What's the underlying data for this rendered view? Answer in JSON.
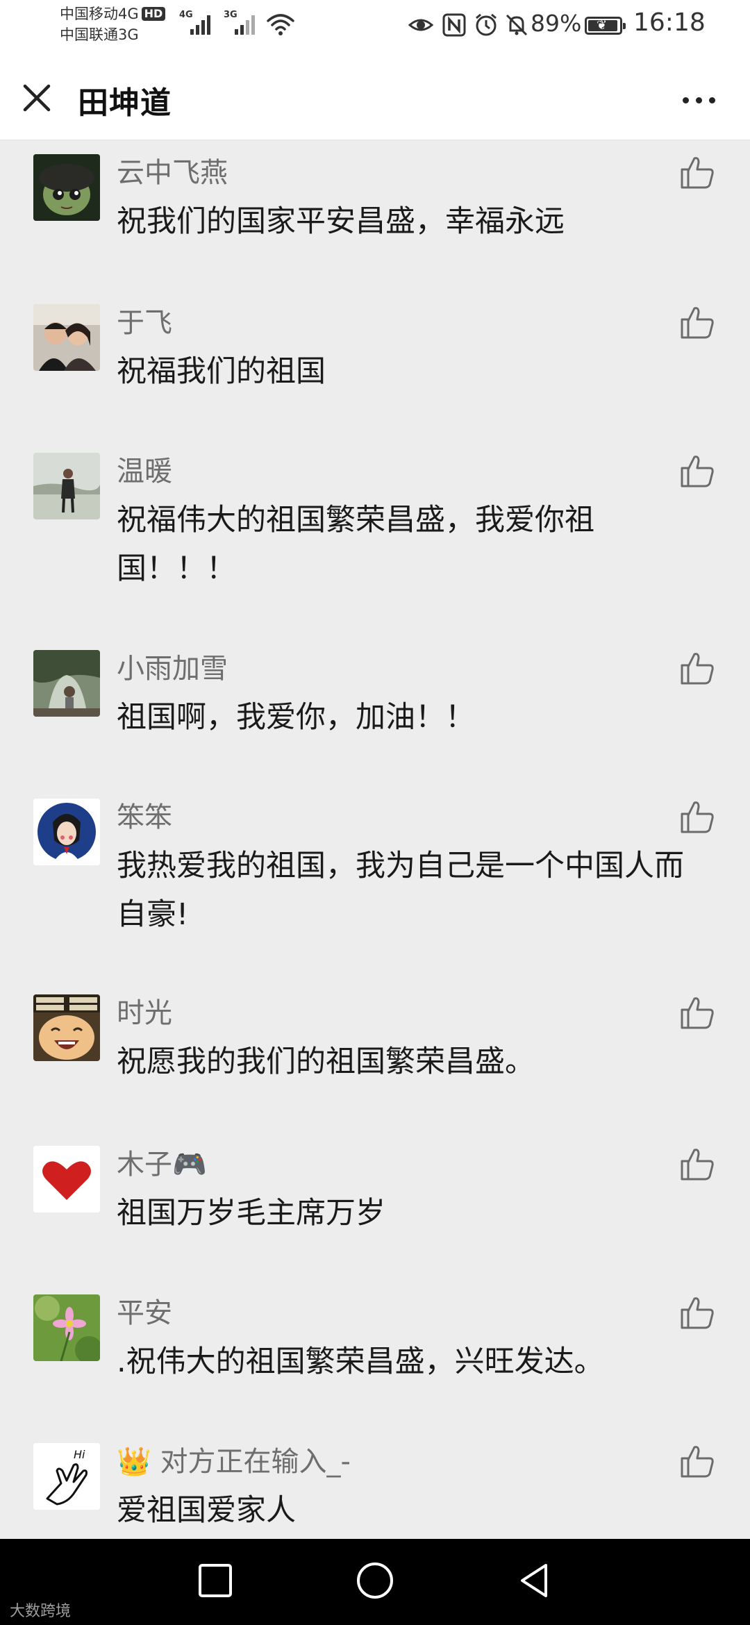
{
  "status_bar": {
    "carrier1": "中国移动4G",
    "hd": "HD",
    "carrier2": "中国联通3G",
    "sig1_gen": "4G",
    "sig2_gen": "3G",
    "battery": "89%",
    "time": "16:18"
  },
  "header": {
    "title": "田坤道"
  },
  "comments": [
    {
      "name": "云中飞燕",
      "text": "祝我们的国家平安昌盛，幸福永远"
    },
    {
      "name": "于飞",
      "text": "祝福我们的祖国"
    },
    {
      "name": "温暖",
      "text": "祝福伟大的祖国繁荣昌盛，我爱你祖国！！！"
    },
    {
      "name": "小雨加雪",
      "text": "祖国啊，我爱你，加油！！"
    },
    {
      "name": "笨笨",
      "text": "我热爱我的祖国，我为自己是一个中国人而自豪!"
    },
    {
      "name": "时光",
      "text": "祝愿我的我们的祖国繁荣昌盛。"
    },
    {
      "name": "木子🎮",
      "text": "祖国万岁毛主席万岁"
    },
    {
      "name": "平安",
      "text": ".祝伟大的祖国繁荣昌盛，兴旺发达。"
    },
    {
      "name": "👑 对方正在输入_-",
      "text": "爱祖国爱家人"
    }
  ],
  "watermark": "大数跨境",
  "colors": {
    "background": "#ededed",
    "name": "#6e6e6e",
    "text": "#1a1a1a"
  }
}
